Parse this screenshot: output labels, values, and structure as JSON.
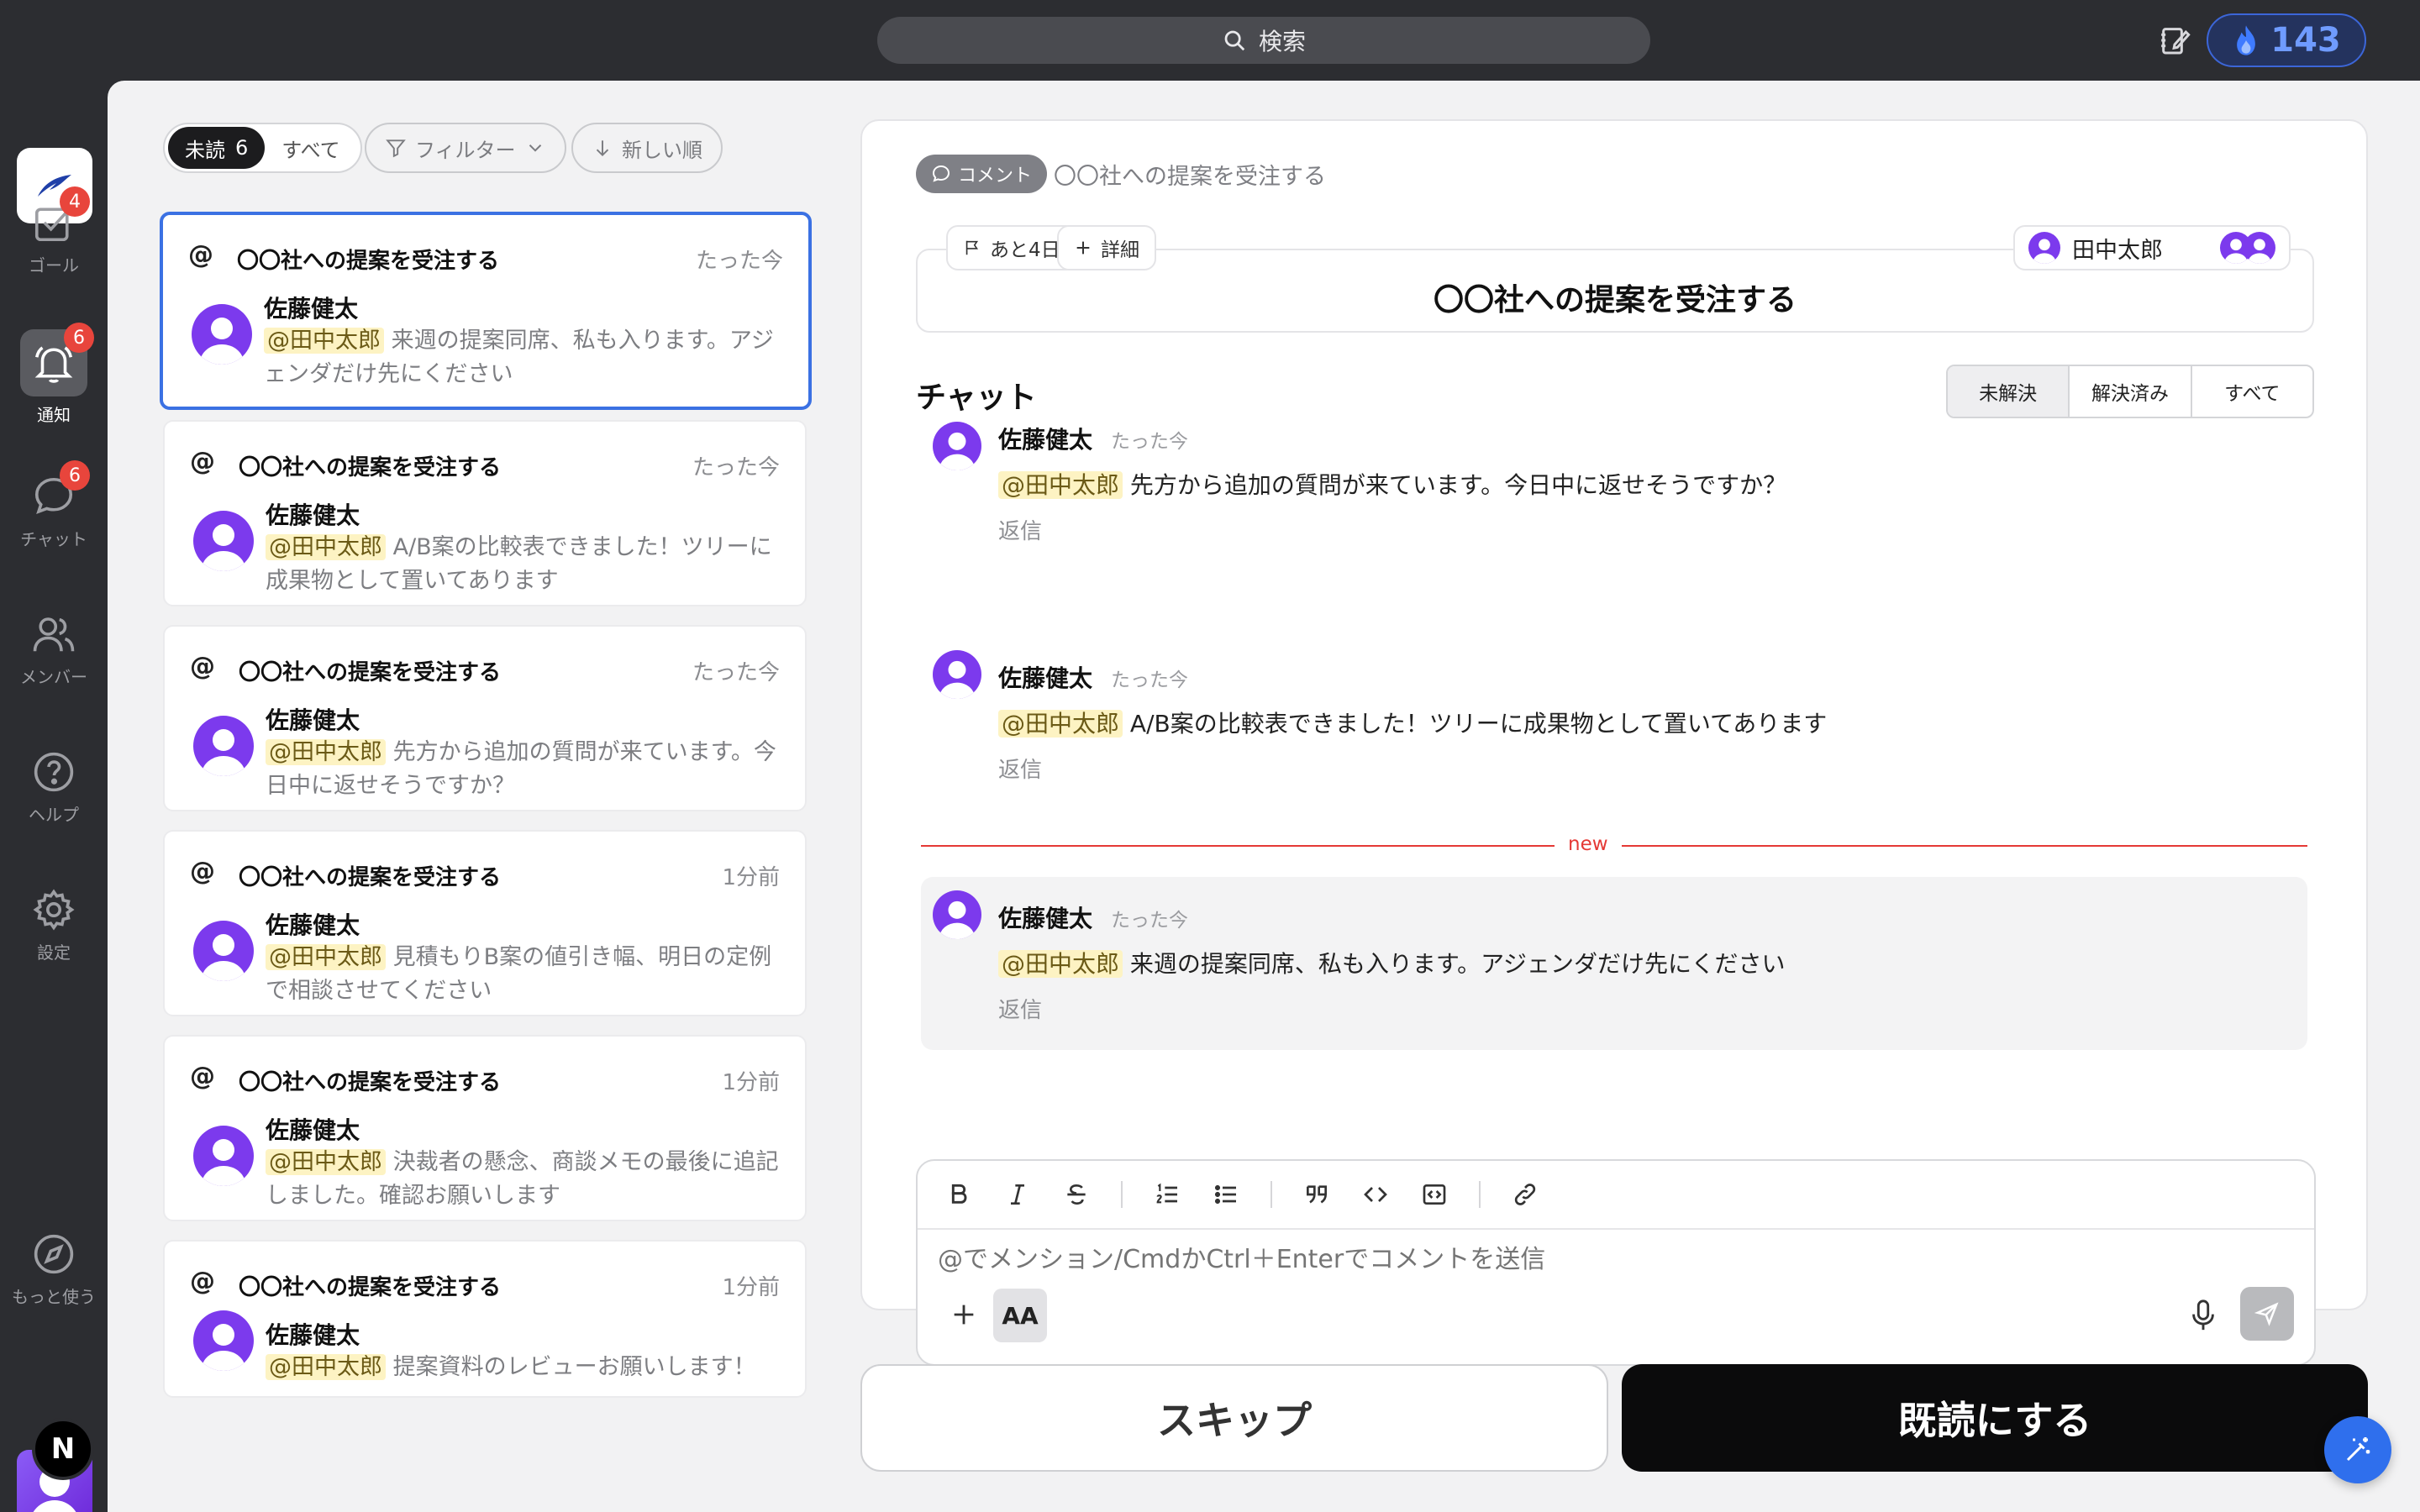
{
  "colors": {
    "accent": "#3b71e3",
    "badge": "#e8453c",
    "mention_bg": "#fdf3c3",
    "new_line": "#e53935",
    "avatar": "#7c3aed"
  },
  "topbar": {
    "search_placeholder": "検索",
    "streak_count": "143",
    "icons": [
      "search-icon",
      "note-edit-icon",
      "flame-icon"
    ]
  },
  "sidebar": {
    "items": [
      {
        "label": "ゴール",
        "badge": "4",
        "icon": "checkbox-icon"
      },
      {
        "label": "通知",
        "badge": "6",
        "icon": "bell-icon"
      },
      {
        "label": "チャット",
        "badge": "6",
        "icon": "chat-bubble-icon"
      },
      {
        "label": "メンバー",
        "icon": "users-icon"
      },
      {
        "label": "ヘルプ",
        "icon": "help-circle-icon"
      },
      {
        "label": "設定",
        "icon": "gear-icon"
      },
      {
        "label": "もっと使う",
        "icon": "compass-icon"
      }
    ],
    "user_initial": "N"
  },
  "filters": {
    "unread_label": "未読",
    "unread_count": "6",
    "all_label": "すべて",
    "filter_label": "フィルター",
    "sort_label": "新しい順"
  },
  "notifications": [
    {
      "title": "〇〇社への提案を受注する",
      "time": "たった今",
      "author": "佐藤健太",
      "mention": "@田中太郎",
      "text": "来週の提案同席、私も入ります。アジェンダだけ先にください"
    },
    {
      "title": "〇〇社への提案を受注する",
      "time": "たった今",
      "author": "佐藤健太",
      "mention": "@田中太郎",
      "text": "A/B案の比較表できました！ツリーに成果物として置いてあります"
    },
    {
      "title": "〇〇社への提案を受注する",
      "time": "たった今",
      "author": "佐藤健太",
      "mention": "@田中太郎",
      "text": "先方から追加の質問が来ています。今日中に返せそうですか？"
    },
    {
      "title": "〇〇社への提案を受注する",
      "time": "1分前",
      "author": "佐藤健太",
      "mention": "@田中太郎",
      "text": "見積もりB案の値引き幅、明日の定例で相談させてください"
    },
    {
      "title": "〇〇社への提案を受注する",
      "time": "1分前",
      "author": "佐藤健太",
      "mention": "@田中太郎",
      "text": "決裁者の懸念、商談メモの最後に追記しました。確認お願いします"
    },
    {
      "title": "〇〇社への提案を受注する",
      "time": "1分前",
      "author": "佐藤健太",
      "mention": "@田中太郎",
      "text": "提案資料のレビューお願いします！"
    }
  ],
  "detail": {
    "chip": "コメント",
    "breadcrumb": "〇〇社への提案を受注する",
    "deadline": "あと4日",
    "details_label": "詳細",
    "task_title": "〇〇社への提案を受注する",
    "assignee": "田中太郎",
    "chat_heading": "チャット",
    "tabs": [
      "未解決",
      "解決済み",
      "すべて"
    ],
    "new_label": "new",
    "messages": [
      {
        "author": "佐藤健太",
        "time": "たった今",
        "mention": "@田中太郎",
        "text": "先方から追加の質問が来ています。今日中に返せそうですか？",
        "reply": "返信"
      },
      {
        "author": "佐藤健太",
        "time": "たった今",
        "mention": "@田中太郎",
        "text": "A/B案の比較表できました！ツリーに成果物として置いてあります",
        "reply": "返信"
      },
      {
        "author": "佐藤健太",
        "time": "たった今",
        "mention": "@田中太郎",
        "text": "来週の提案同席、私も入ります。アジェンダだけ先にください",
        "reply": "返信"
      }
    ],
    "composer_placeholder": "@でメンション/CmdかCtrl＋Enterでコメントを送信",
    "text_format_label": "AA"
  },
  "actions": {
    "skip": "スキップ",
    "mark_read": "既読にする"
  }
}
